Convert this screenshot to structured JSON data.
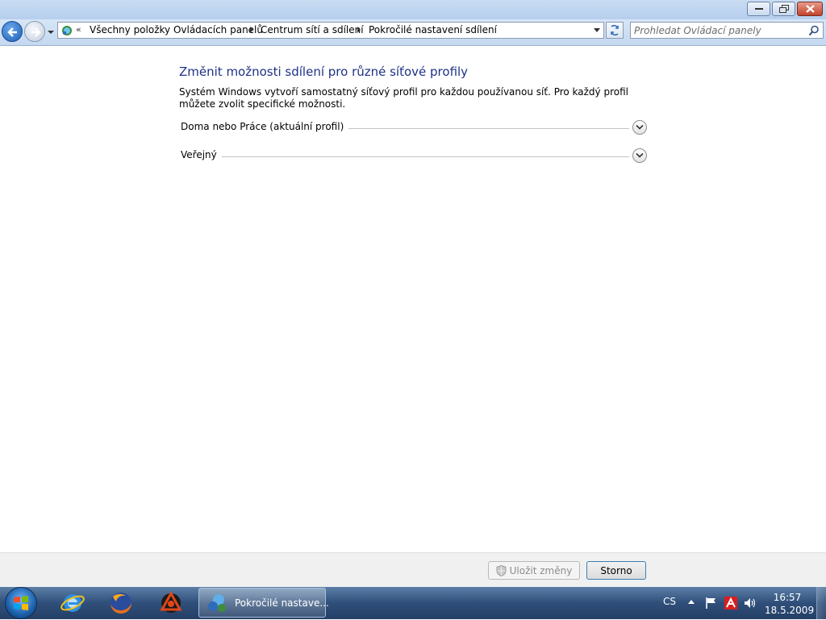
{
  "window": {
    "minimize_icon": "minimize-icon",
    "maximize_icon": "restore-icon",
    "close_icon": "close-icon"
  },
  "navigation": {
    "chevron": "«",
    "breadcrumbs": [
      {
        "label": "Všechny položky Ovládacích panelů"
      },
      {
        "label": "Centrum sítí a sdílení"
      },
      {
        "label": "Pokročilé nastavení sdílení"
      }
    ],
    "search_placeholder": "Prohledat Ovládací panely"
  },
  "main": {
    "title": "Změnit možnosti sdílení pro různé síťové profily",
    "description": "Systém Windows vytvoří samostatný síťový profil pro každou používanou síť. Pro každý profil můžete zvolit specifické možnosti.",
    "profiles": [
      {
        "label": "Doma nebo Práce (aktuální profil)",
        "expanded": false
      },
      {
        "label": "Veřejný",
        "expanded": false
      }
    ]
  },
  "footer": {
    "save_label": "Uložit změny",
    "save_enabled": false,
    "cancel_label": "Storno"
  },
  "taskbar": {
    "pinned": [
      "internet-explorer-icon",
      "firefox-icon",
      "reason-icon"
    ],
    "active_task_label": "Pokročilé nastave...",
    "language": "CS",
    "time": "16:57",
    "date": "18.5.2009"
  },
  "colors": {
    "title_blue": "#1e3287",
    "taskbar": "#2f4f7a"
  }
}
